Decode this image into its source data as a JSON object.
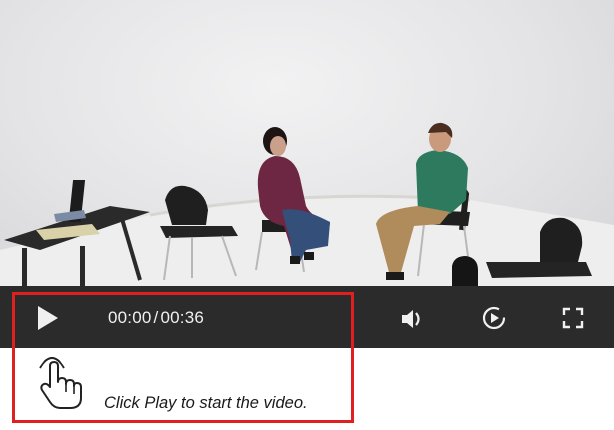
{
  "player": {
    "current_time": "00:00",
    "separator": "/",
    "duration": "00:36",
    "hint_text": "Click Play to start the video."
  },
  "icons": {
    "play": "play-icon",
    "volume": "volume-icon",
    "speed": "playback-speed-icon",
    "fullscreen": "fullscreen-icon",
    "pointer": "hand-pointer-icon"
  },
  "colors": {
    "control_bar": "#2b2b2b",
    "highlight_border": "#e02020",
    "control_text": "#f0f0f0"
  }
}
